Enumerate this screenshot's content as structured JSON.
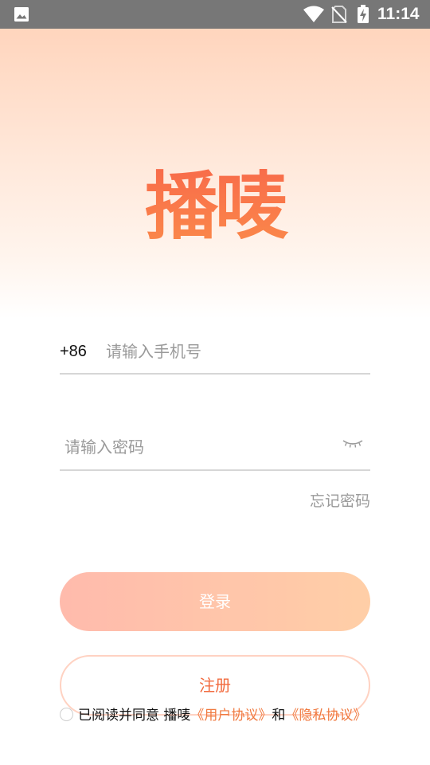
{
  "status_bar": {
    "time": "11:14"
  },
  "app": {
    "logo_text": "播唛"
  },
  "login_form": {
    "country_code": "+86",
    "phone_placeholder": "请输入手机号",
    "password_placeholder": "请输入密码",
    "forgot_password": "忘记密码",
    "login_button": "登录",
    "register_button": "注册"
  },
  "agreement": {
    "prefix": "已阅读并同意 播唛",
    "user_agreement": "《用户协议》",
    "conjunction": "和",
    "privacy_policy": "《隐私协议》"
  },
  "colors": {
    "status_bar": "#777777",
    "accent": "#f26b3f",
    "hero_top": "#ffd5bd"
  },
  "icons": [
    "photo-icon",
    "wifi-icon",
    "sim-off-icon",
    "battery-charging-icon",
    "eye-closed-icon"
  ]
}
